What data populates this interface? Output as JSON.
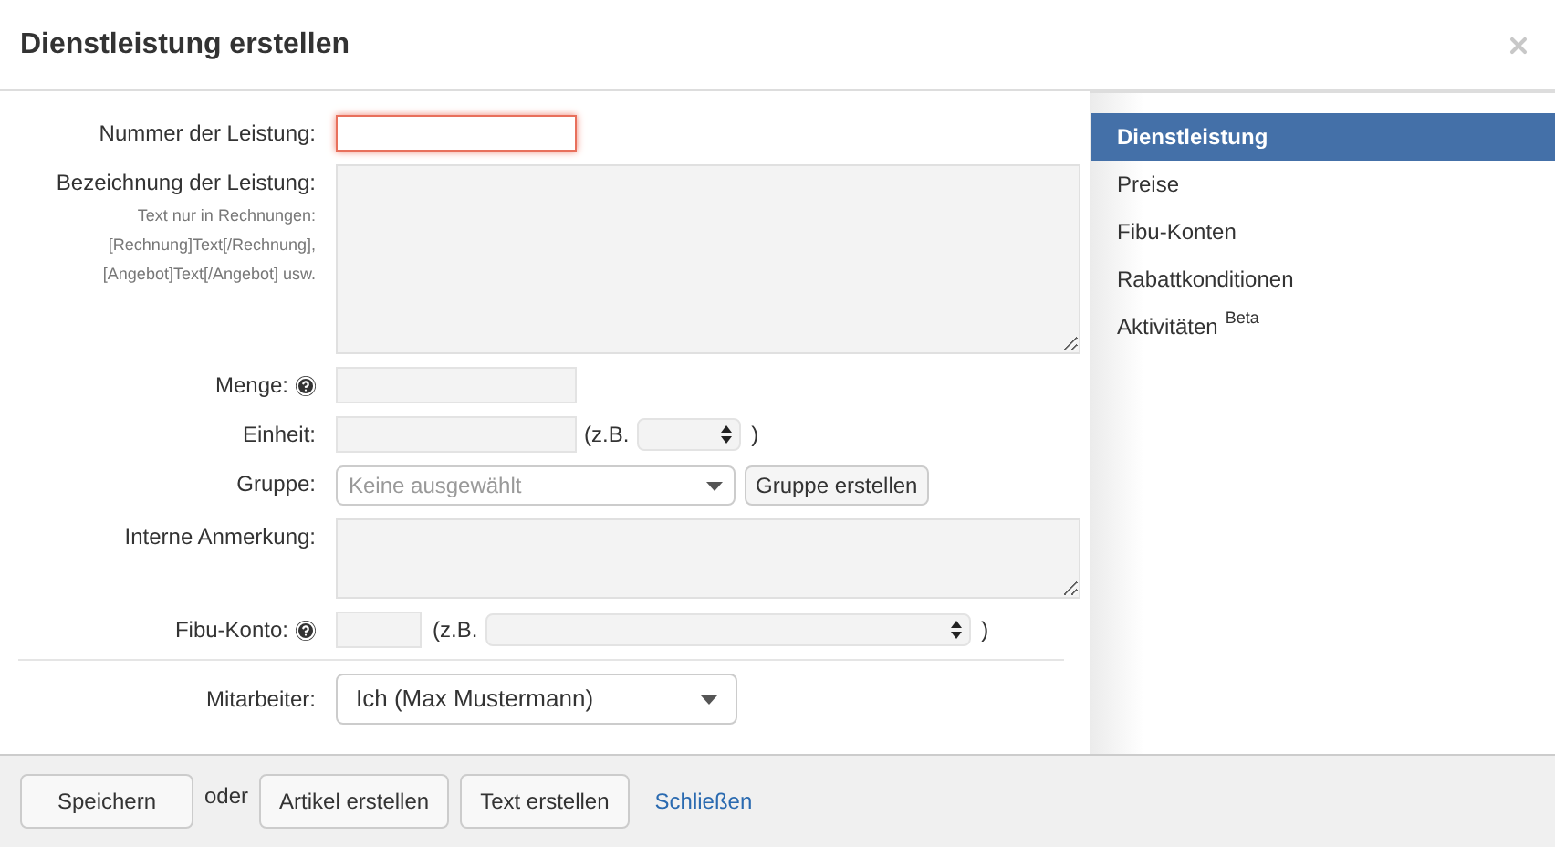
{
  "dialog": {
    "title": "Dienstleistung erstellen"
  },
  "form": {
    "fields": [
      {
        "kind": "text",
        "label": "Nummer der Leistung:",
        "focused": true,
        "help": false
      },
      {
        "kind": "textarea",
        "label": "Bezeichnung der Leistung:",
        "hint": [
          "Text nur in Rechnungen:",
          "[Rechnung]Text[/Rechnung],",
          "[Angebot]Text[/Angebot] usw."
        ]
      },
      {
        "kind": "text",
        "label": "Menge:",
        "focused": false,
        "help": true
      },
      {
        "kind": "unit",
        "label": "Einheit:",
        "example_open": "(z.B.",
        "example_close": ")"
      },
      {
        "kind": "group",
        "label": "Gruppe:",
        "placeholder": "Keine ausgewählt",
        "button": "Gruppe erstellen"
      },
      {
        "kind": "textarea",
        "label": "Interne Anmerkung:"
      },
      {
        "kind": "account",
        "label": "Fibu-Konto:",
        "help": true,
        "example_open": "(z.B.",
        "example_close": ")"
      }
    ],
    "employee": {
      "label": "Mitarbeiter:",
      "value": "Ich (Max Mustermann)"
    }
  },
  "sidebar": {
    "items": [
      {
        "label": "Dienstleistung",
        "selected": true
      },
      {
        "label": "Preise",
        "selected": false
      },
      {
        "label": "Fibu-Konten",
        "selected": false
      },
      {
        "label": "Rabattkonditionen",
        "selected": false
      },
      {
        "label": "Aktivitäten",
        "badge": "Beta",
        "selected": false
      }
    ]
  },
  "footer": {
    "save": "Speichern",
    "or": "oder",
    "buttons": [
      "Artikel erstellen",
      "Text erstellen"
    ],
    "close_link": "Schließen"
  }
}
